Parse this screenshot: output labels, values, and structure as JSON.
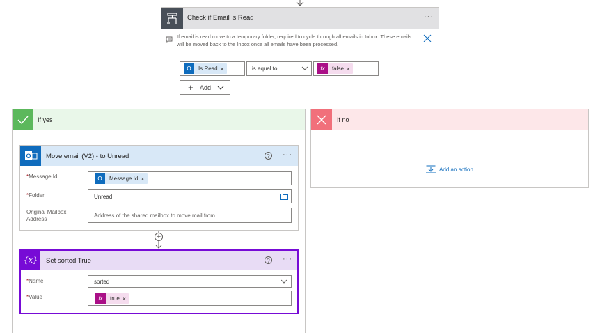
{
  "condition": {
    "title": "Check if Email is Read",
    "comment": "If email is read move to a temporary folder, required to cycle through all emails in Inbox. These emails will be moved back to the Inbox once all emails have been processed.",
    "left_token": "Is Read",
    "operator": "is equal to",
    "right_token": "false",
    "add_label": "Add"
  },
  "yes_branch": {
    "title": "If yes"
  },
  "no_branch": {
    "title": "If no",
    "add_action": "Add an action"
  },
  "move_email": {
    "title": "Move email (V2) - to Unread",
    "fields": {
      "message_id_label": "Message Id",
      "message_id_token": "Message Id",
      "folder_label": "Folder",
      "folder_value": "Unread",
      "mailbox_label_line1": "Original Mailbox",
      "mailbox_label_line2": "Address",
      "mailbox_placeholder": "Address of the shared mailbox to move mail from."
    }
  },
  "set_variable": {
    "title": "Set sorted True",
    "icon_text": "{x}",
    "name_label": "Name",
    "name_value": "sorted",
    "value_label": "Value",
    "value_token": "true"
  },
  "icons": {
    "condition": "condition-icon",
    "outlook": "outlook-icon",
    "variable": "variable-icon",
    "function": "fx-icon"
  },
  "colors": {
    "condition_header": "#e1e1e3",
    "yes_header": "#e9f7e9",
    "yes_icon": "#5cb85c",
    "no_header": "#fde7e9",
    "no_icon": "#f1707b",
    "outlook_header": "#d8e8f7",
    "outlook_icon": "#0f6cbd",
    "variable_header": "#e8dcf5",
    "variable_icon": "#770bd6",
    "fx_token": "#aa0f87",
    "link": "#0f6cbd"
  }
}
